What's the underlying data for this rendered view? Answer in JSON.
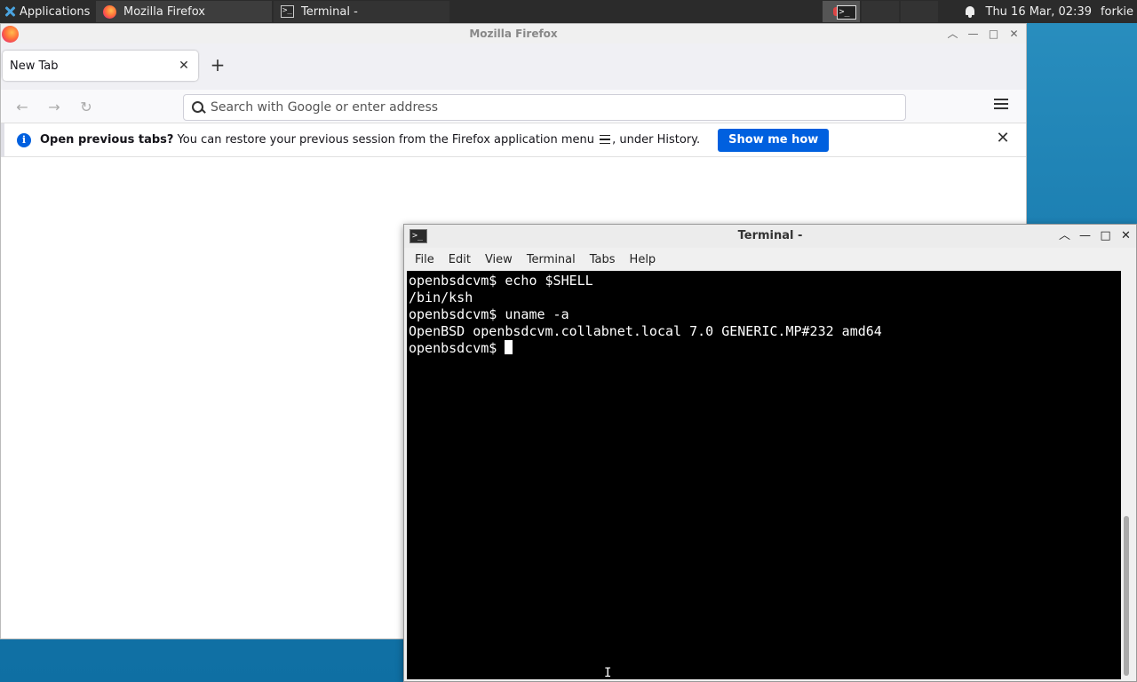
{
  "panel": {
    "apps_label": "Applications",
    "tasks": [
      {
        "label": "Mozilla Firefox",
        "icon": "firefox-icon"
      },
      {
        "label": "Terminal -",
        "icon": "terminal-icon"
      }
    ],
    "clock": "Thu 16 Mar, 02:39",
    "user": "forkie"
  },
  "firefox": {
    "window_title": "Mozilla Firefox",
    "tab_label": "New Tab",
    "url_placeholder": "Search with Google or enter address",
    "infobar": {
      "bold": "Open previous tabs?",
      "text_before": " You can restore your previous session from the Firefox application menu ",
      "text_after": ", under History.",
      "button": "Show me how"
    }
  },
  "terminal": {
    "window_title": "Terminal -",
    "menu": [
      "File",
      "Edit",
      "View",
      "Terminal",
      "Tabs",
      "Help"
    ],
    "lines": [
      "openbsdcvm$ echo $SHELL",
      "/bin/ksh",
      "openbsdcvm$ uname -a",
      "OpenBSD openbsdcvm.collabnet.local 7.0 GENERIC.MP#232 amd64"
    ],
    "prompt": "openbsdcvm$ "
  },
  "colors": {
    "accent": "#0060df",
    "desktop": "#1a7db0",
    "panel": "#2b2b2b"
  }
}
